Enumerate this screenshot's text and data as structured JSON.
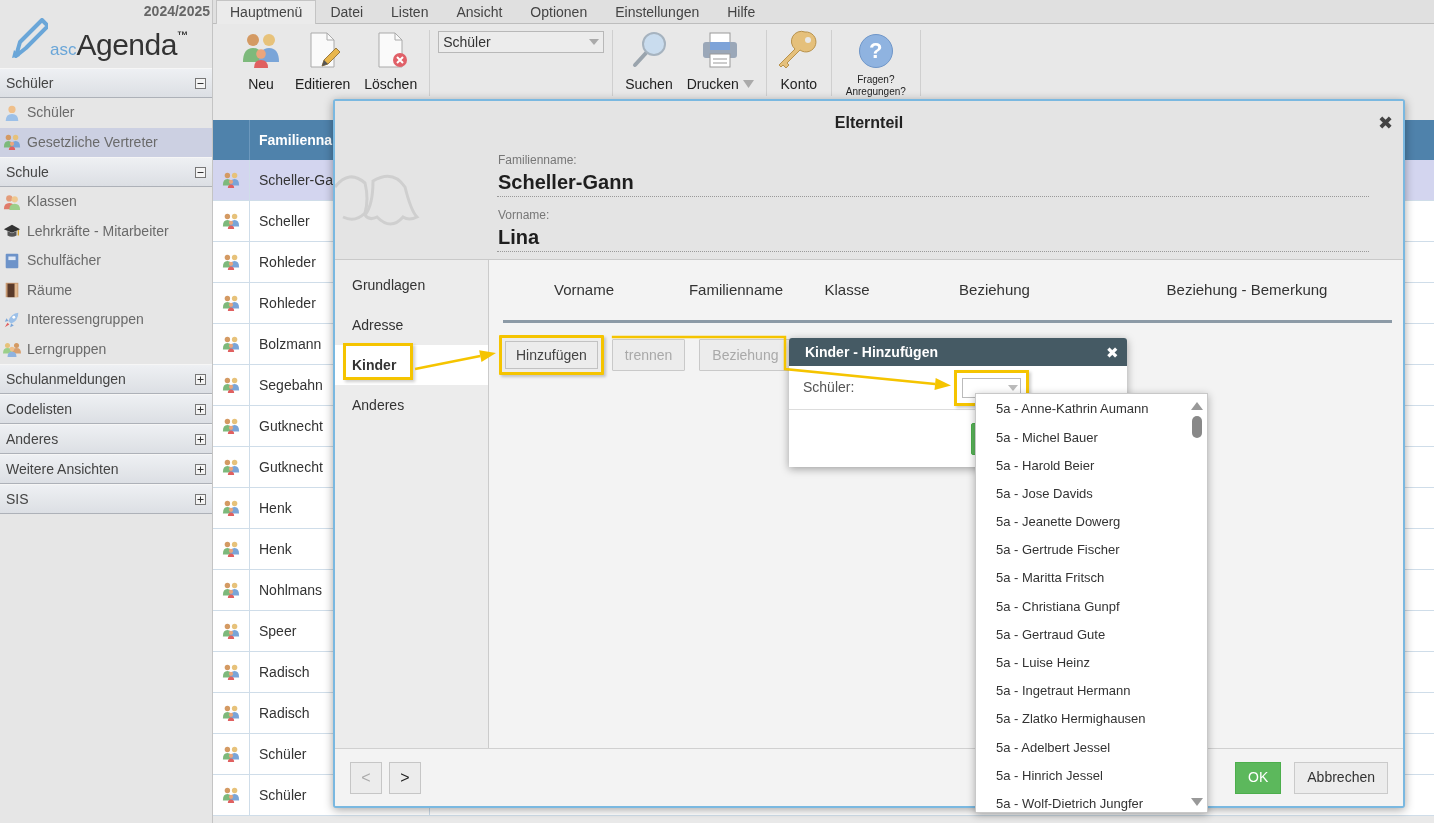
{
  "app": {
    "logo_prefix": "asc",
    "logo_name": "Agenda",
    "logo_mark": "™",
    "school_year": "2024/2025"
  },
  "sidebar": {
    "sections": [
      {
        "title": "Schüler",
        "expanded": true,
        "items": [
          {
            "label": "Schüler",
            "selected": false
          },
          {
            "label": "Gesetzliche Vertreter",
            "selected": true
          }
        ]
      },
      {
        "title": "Schule",
        "expanded": true,
        "items": [
          {
            "label": "Klassen",
            "selected": false
          },
          {
            "label": "Lehrkräfte - Mitarbeiter",
            "selected": false
          },
          {
            "label": "Schulfächer",
            "selected": false
          },
          {
            "label": "Räume",
            "selected": false
          },
          {
            "label": "Interessengruppen",
            "selected": false
          },
          {
            "label": "Lerngruppen",
            "selected": false
          }
        ]
      },
      {
        "title": "Schulanmeldungen",
        "expanded": false
      },
      {
        "title": "Codelisten",
        "expanded": false
      },
      {
        "title": "Anderes",
        "expanded": false
      },
      {
        "title": "Weitere Ansichten",
        "expanded": false
      },
      {
        "title": "SIS",
        "expanded": false
      }
    ]
  },
  "menu_tabs": [
    {
      "label": "Hauptmenü",
      "selected": true
    },
    {
      "label": "Datei",
      "selected": false
    },
    {
      "label": "Listen",
      "selected": false
    },
    {
      "label": "Ansicht",
      "selected": false
    },
    {
      "label": "Optionen",
      "selected": false
    },
    {
      "label": "Einstellungen",
      "selected": false
    },
    {
      "label": "Hilfe",
      "selected": false
    }
  ],
  "toolbar": {
    "groups": [
      {
        "kind": "buttons",
        "buttons": [
          {
            "label": "Neu"
          },
          {
            "label": "Editieren"
          },
          {
            "label": "Löschen"
          }
        ]
      },
      {
        "kind": "select",
        "value": "Schüler"
      },
      {
        "kind": "buttons",
        "buttons": [
          {
            "label": "Suchen"
          },
          {
            "label": "Drucken",
            "has_menu": true
          }
        ]
      },
      {
        "kind": "buttons",
        "buttons": [
          {
            "label": "Konto"
          }
        ]
      },
      {
        "kind": "buttons",
        "buttons": [
          {
            "label": "Fragen? Anregungen?",
            "glyph": "?",
            "small": true
          }
        ]
      }
    ]
  },
  "table": {
    "header": "Familienna",
    "rows": [
      {
        "name": "Scheller-Ga",
        "selected": true
      },
      {
        "name": "Scheller",
        "selected": false
      },
      {
        "name": "Rohleder",
        "selected": false
      },
      {
        "name": "Rohleder",
        "selected": false
      },
      {
        "name": "Bolzmann",
        "selected": false
      },
      {
        "name": "Segebahn",
        "selected": false
      },
      {
        "name": "Gutknecht",
        "selected": false
      },
      {
        "name": "Gutknecht",
        "selected": false
      },
      {
        "name": "Henk",
        "selected": false
      },
      {
        "name": "Henk",
        "selected": false
      },
      {
        "name": "Nohlmans",
        "selected": false
      },
      {
        "name": "Speer",
        "selected": false
      },
      {
        "name": "Radisch",
        "selected": false
      },
      {
        "name": "Radisch",
        "selected": false
      },
      {
        "name": "Schüler",
        "selected": false
      },
      {
        "name": "Schüler",
        "selected": false
      }
    ]
  },
  "dialog": {
    "title": "Elternteil",
    "close": "✖",
    "fields": [
      {
        "label": "Familienname:",
        "value": "Scheller-Gann"
      },
      {
        "label": "Vorname:",
        "value": "Lina"
      }
    ],
    "nav": [
      {
        "label": "Grundlagen",
        "selected": false,
        "highlighted": false
      },
      {
        "label": "Adresse",
        "selected": false,
        "highlighted": false
      },
      {
        "label": "Kinder",
        "selected": true,
        "highlighted": true
      },
      {
        "label": "Anderes",
        "selected": false,
        "highlighted": false
      }
    ],
    "columns": [
      "Vorname",
      "Familienname",
      "Klasse",
      "Beziehung",
      "Beziehung - Bemerkung"
    ],
    "buttons": [
      {
        "label": "Hinzufügen",
        "disabled": false,
        "highlighted": true
      },
      {
        "label": "trennen",
        "disabled": true,
        "highlighted": false
      },
      {
        "label": "Beziehung",
        "disabled": true,
        "highlighted": false
      }
    ],
    "prev": {
      "label": "<",
      "disabled": true
    },
    "next": {
      "label": ">",
      "disabled": false
    },
    "ok": "OK",
    "cancel": "Abbrechen"
  },
  "add_dialog": {
    "title": "Kinder - Hinzufügen",
    "close": "✖",
    "field_label": "Schüler:",
    "select_highlighted": true,
    "options": [
      "5a - Anne-Kathrin Aumann",
      "5a - Michel Bauer",
      "5a - Harold Beier",
      "5a - Jose Davids",
      "5a - Jeanette Dowerg",
      "5a - Gertrude Fischer",
      "5a - Maritta Fritsch",
      "5a - Christiana Gunpf",
      "5a - Gertraud Gute",
      "5a - Luise Heinz",
      "5a - Ingetraut Hermann",
      "5a - Zlatko Hermighausen",
      "5a - Adelbert Jessel",
      "5a - Hinrich Jessel",
      "5a - Wolf-Dietrich Jungfer"
    ]
  }
}
